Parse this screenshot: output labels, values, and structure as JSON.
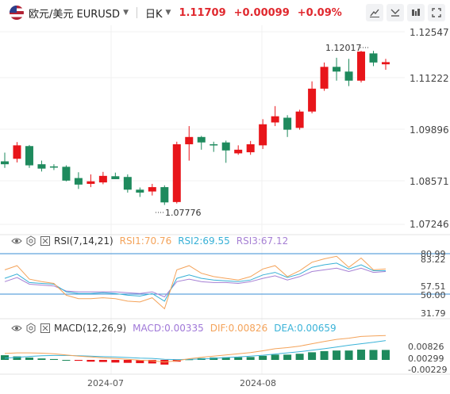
{
  "header": {
    "symbol_display": "欧元/美元 EURUSD",
    "interval": "日K",
    "last_price": "1.11709",
    "change": "+0.00099",
    "change_pct": "+0.09%",
    "up_color": "#e0282e",
    "toolbar_icons": [
      "draw-tools-icon",
      "indicators-icon",
      "layers-icon",
      "fullscreen-icon"
    ]
  },
  "colors": {
    "up": "#e8151a",
    "down": "#1e8a5d",
    "rsi1": "#f4a35a",
    "rsi2": "#37b0d6",
    "rsi3": "#a680d4",
    "macd": "#a078d8",
    "dif": "#f4a35a",
    "dea": "#3ab3d8",
    "level_line": "#3a8ed6"
  },
  "main_pane": {
    "price_labels": [
      "1.12547",
      "1.11222",
      "1.09896",
      "1.08571",
      "1.07246"
    ],
    "high_label": "1.12017",
    "low_label": "1.07776"
  },
  "rsi_pane": {
    "title": "RSI(7,14,21)",
    "rsi1": "RSI1:70.76",
    "rsi2": "RSI2:69.55",
    "rsi3": "RSI3:67.12",
    "axis_labels": [
      "80.99",
      "83.22",
      "57.51",
      "50.00",
      "31.79"
    ]
  },
  "macd_pane": {
    "title": "MACD(12,26,9)",
    "macd": "MACD:0.00335",
    "dif": "DIF:0.00826",
    "dea": "DEA:0.00659",
    "axis_labels": [
      "0.00826",
      "0.00299",
      "-0.00229"
    ]
  },
  "x_axis": {
    "labels": [
      "2024-07",
      "2024-08"
    ]
  },
  "chart_data": {
    "type": "candlestick",
    "title": "EURUSD 日K",
    "price_axis": [
      1.07246,
      1.12547
    ],
    "candles": [
      {
        "o": 1.0898,
        "h": 1.0922,
        "l": 1.088,
        "c": 1.089
      },
      {
        "o": 1.0905,
        "h": 1.0951,
        "l": 1.0895,
        "c": 1.0942
      },
      {
        "o": 1.094,
        "h": 1.0943,
        "l": 1.088,
        "c": 1.0887
      },
      {
        "o": 1.089,
        "h": 1.09,
        "l": 1.087,
        "c": 1.0878
      },
      {
        "o": 1.0884,
        "h": 1.089,
        "l": 1.0874,
        "c": 1.0882
      },
      {
        "o": 1.0883,
        "h": 1.0887,
        "l": 1.0843,
        "c": 1.0845
      },
      {
        "o": 1.0852,
        "h": 1.0868,
        "l": 1.0822,
        "c": 1.0834
      },
      {
        "o": 1.0836,
        "h": 1.0862,
        "l": 1.0827,
        "c": 1.0843
      },
      {
        "o": 1.084,
        "h": 1.0869,
        "l": 1.0835,
        "c": 1.0858
      },
      {
        "o": 1.0857,
        "h": 1.0867,
        "l": 1.0851,
        "c": 1.0849
      },
      {
        "o": 1.0855,
        "h": 1.0862,
        "l": 1.0812,
        "c": 1.082
      },
      {
        "o": 1.082,
        "h": 1.0826,
        "l": 1.08,
        "c": 1.0812
      },
      {
        "o": 1.0815,
        "h": 1.0836,
        "l": 1.0804,
        "c": 1.0827
      },
      {
        "o": 1.0827,
        "h": 1.0832,
        "l": 1.0778,
        "c": 1.0785
      },
      {
        "o": 1.0786,
        "h": 1.0952,
        "l": 1.0782,
        "c": 1.0945
      },
      {
        "o": 1.0945,
        "h": 1.0995,
        "l": 1.09,
        "c": 1.0965
      },
      {
        "o": 1.0965,
        "h": 1.0968,
        "l": 1.093,
        "c": 1.095
      },
      {
        "o": 1.0945,
        "h": 1.0952,
        "l": 1.0924,
        "c": 1.0942
      },
      {
        "o": 1.095,
        "h": 1.0955,
        "l": 1.0894,
        "c": 1.0928
      },
      {
        "o": 1.092,
        "h": 1.0942,
        "l": 1.0916,
        "c": 1.093
      },
      {
        "o": 1.0923,
        "h": 1.0954,
        "l": 1.0916,
        "c": 1.0945
      },
      {
        "o": 1.0942,
        "h": 1.1014,
        "l": 1.0932,
        "c": 1.1
      },
      {
        "o": 1.1005,
        "h": 1.105,
        "l": 1.0995,
        "c": 1.1022
      },
      {
        "o": 1.1018,
        "h": 1.1025,
        "l": 1.0965,
        "c": 1.0985
      },
      {
        "o": 1.099,
        "h": 1.104,
        "l": 1.0985,
        "c": 1.1035
      },
      {
        "o": 1.1035,
        "h": 1.1118,
        "l": 1.103,
        "c": 1.1098
      },
      {
        "o": 1.1098,
        "h": 1.117,
        "l": 1.1092,
        "c": 1.1158
      },
      {
        "o": 1.1158,
        "h": 1.1183,
        "l": 1.112,
        "c": 1.1145
      },
      {
        "o": 1.1145,
        "h": 1.118,
        "l": 1.1105,
        "c": 1.112
      },
      {
        "o": 1.112,
        "h": 1.1202,
        "l": 1.1115,
        "c": 1.12
      },
      {
        "o": 1.1195,
        "h": 1.1202,
        "l": 1.116,
        "c": 1.117
      },
      {
        "o": 1.1165,
        "h": 1.118,
        "l": 1.115,
        "c": 1.1171
      }
    ],
    "rsi": {
      "rsi1": [
        74,
        79,
        63,
        60,
        58,
        44,
        40,
        40,
        41,
        40,
        37,
        36,
        41,
        28,
        74,
        79,
        70,
        66,
        64,
        62,
        66,
        75,
        79,
        66,
        73,
        83,
        87,
        90,
        77,
        88,
        74,
        75
      ],
      "rsi2": [
        64,
        69,
        59,
        58,
        57,
        48,
        46,
        46,
        47,
        46,
        44,
        43,
        46,
        37,
        64,
        68,
        64,
        62,
        61,
        60,
        62,
        68,
        71,
        65,
        69,
        77,
        80,
        82,
        75,
        80,
        73,
        73
      ],
      "rsi3": [
        60,
        65,
        57,
        56,
        55,
        49,
        48,
        48,
        48,
        48,
        47,
        46,
        48,
        42,
        60,
        63,
        60,
        59,
        59,
        58,
        60,
        64,
        67,
        62,
        66,
        72,
        74,
        76,
        72,
        76,
        71,
        72
      ]
    },
    "macd": {
      "hist": [
        0.0016,
        0.0012,
        0.0008,
        0.0005,
        0.0003,
        0.0,
        -0.0003,
        -0.0006,
        -0.0007,
        -0.0009,
        -0.001,
        -0.0011,
        -0.0012,
        -0.0016,
        -0.0006,
        0.0002,
        0.0006,
        0.0008,
        0.0009,
        0.0009,
        0.001,
        0.0014,
        0.0018,
        0.0018,
        0.0021,
        0.0026,
        0.003,
        0.0032,
        0.0032,
        0.0035,
        0.0034,
        0.0034
      ],
      "dif": [
        0.0022,
        0.0024,
        0.0024,
        0.0023,
        0.0021,
        0.0017,
        0.0013,
        0.001,
        0.0007,
        0.0005,
        0.0002,
        -0.0001,
        -0.0003,
        -0.0007,
        -0.0003,
        0.0004,
        0.0009,
        0.0013,
        0.0017,
        0.0021,
        0.0025,
        0.0031,
        0.0038,
        0.0042,
        0.0047,
        0.0055,
        0.0063,
        0.007,
        0.0074,
        0.008,
        0.0082,
        0.0083
      ],
      "dea": [
        0.0006,
        0.0009,
        0.0012,
        0.0014,
        0.0015,
        0.0015,
        0.0014,
        0.0013,
        0.0011,
        0.001,
        0.0008,
        0.0006,
        0.0005,
        0.0002,
        0.0001,
        0.0002,
        0.0003,
        0.0005,
        0.0008,
        0.001,
        0.0013,
        0.0016,
        0.002,
        0.0024,
        0.0028,
        0.0033,
        0.0038,
        0.0044,
        0.005,
        0.0055,
        0.006,
        0.0066
      ]
    }
  }
}
